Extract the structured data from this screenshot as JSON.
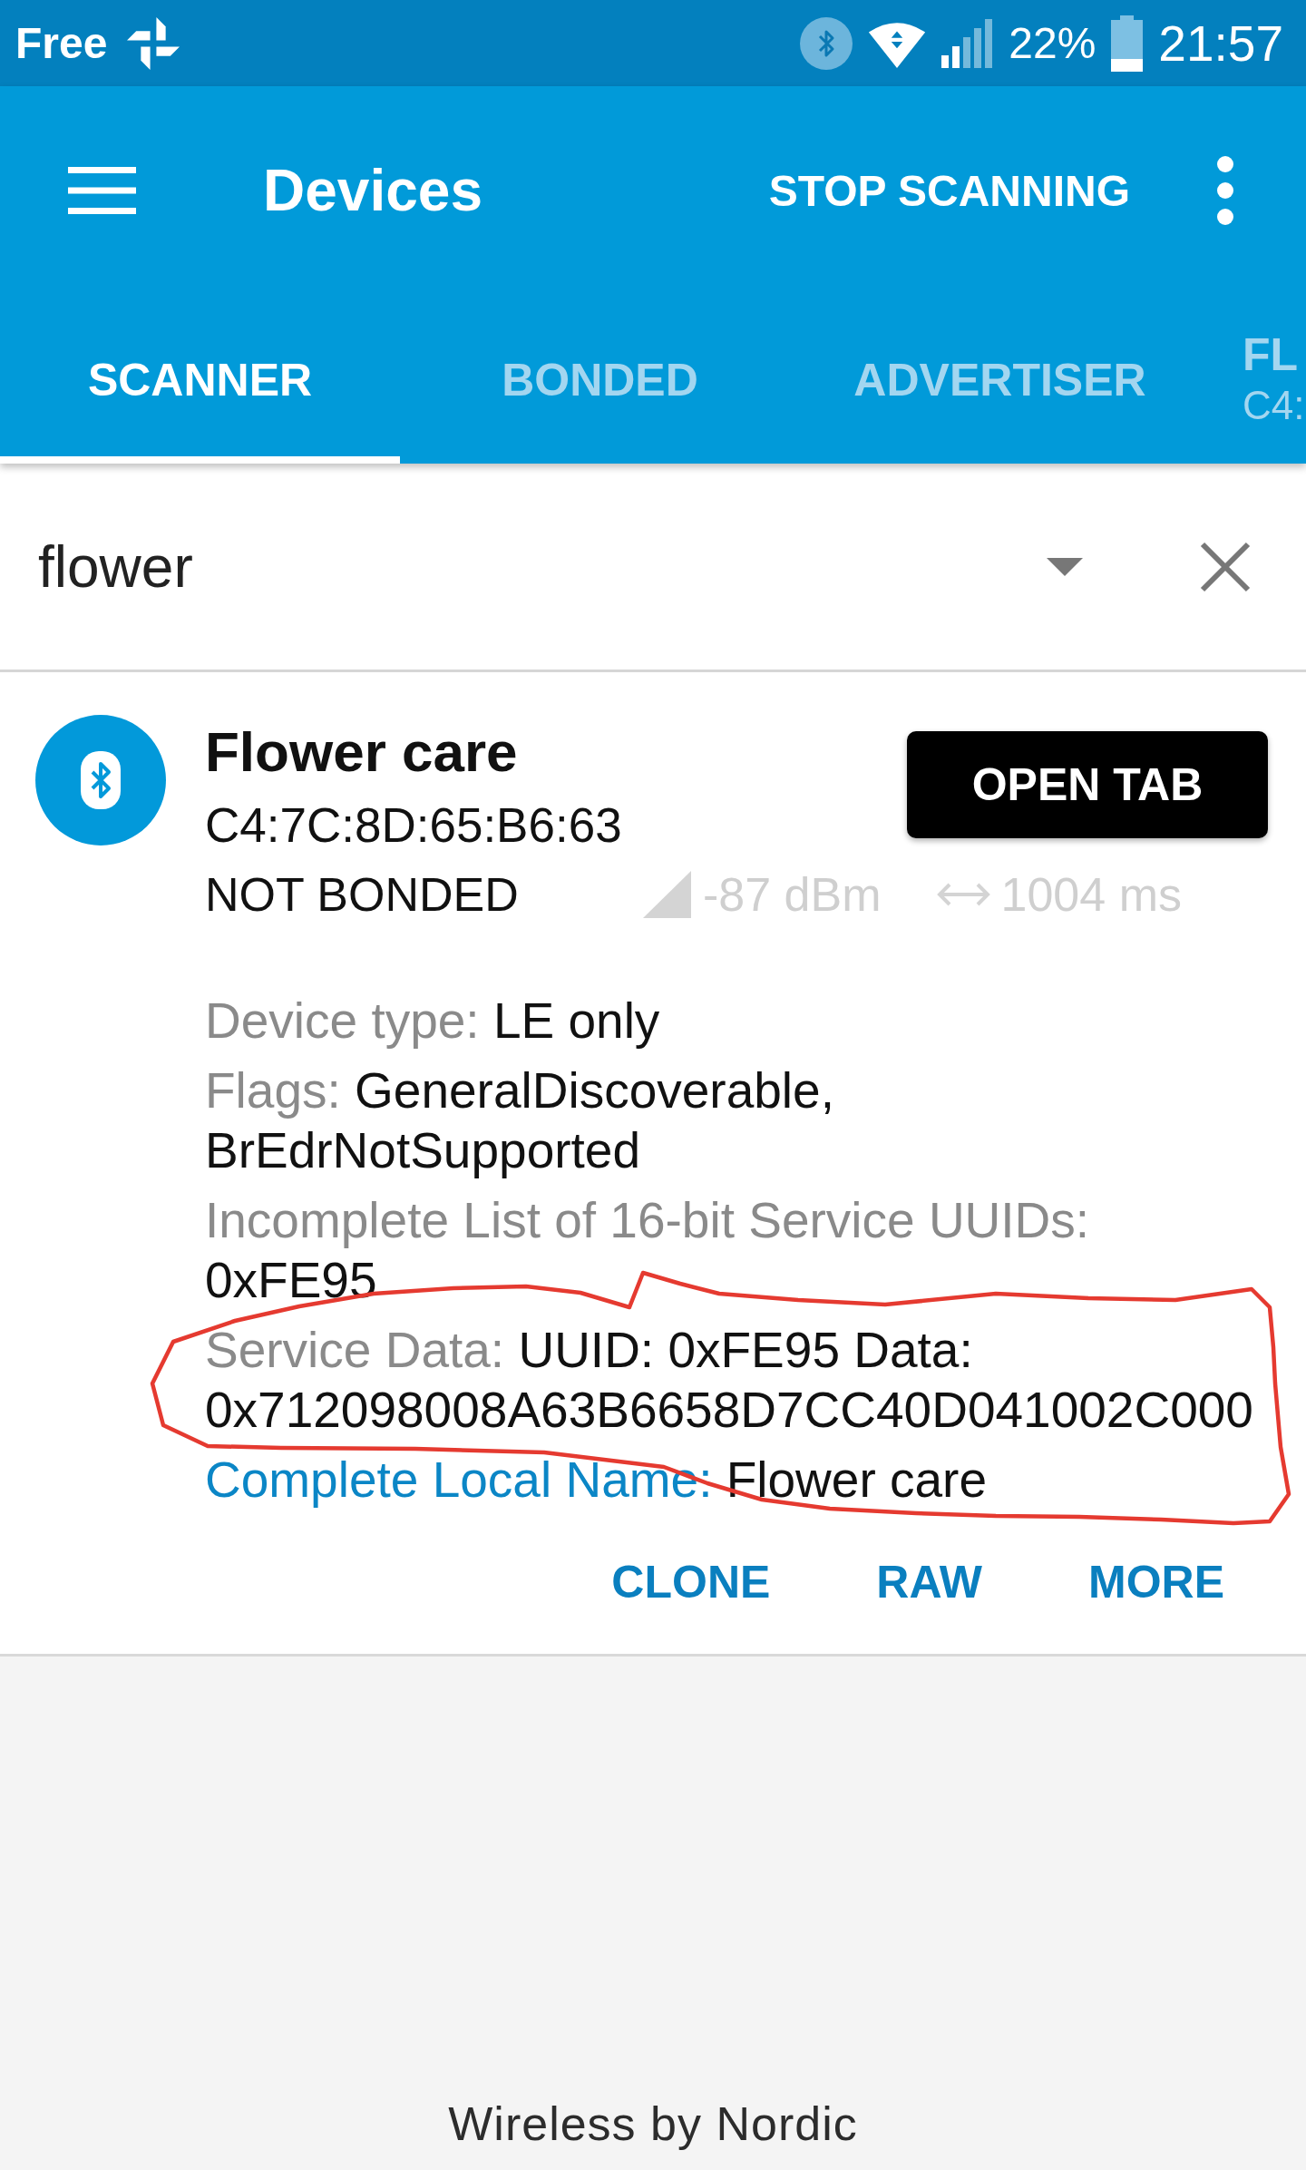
{
  "status_bar": {
    "carrier": "Free",
    "battery": "22%",
    "time": "21:57"
  },
  "app_bar": {
    "title": "Devices",
    "action": "STOP SCANNING"
  },
  "tabs": [
    {
      "kind": "text",
      "label": "SCANNER",
      "selected": true
    },
    {
      "kind": "text",
      "label": "BONDED",
      "selected": false
    },
    {
      "kind": "text",
      "label": "ADVERTISER",
      "selected": false
    },
    {
      "kind": "device",
      "label": "FL",
      "detail": "C4:",
      "selected": false
    }
  ],
  "filter": {
    "value": "flower"
  },
  "devices": [
    {
      "name": "Flower care",
      "address": "C4:7C:8D:65:B6:63",
      "bond_state": "NOT BONDED",
      "rssi": "-87 dBm",
      "interval": "1004 ms",
      "action": "OPEN TAB",
      "details": [
        {
          "label": "Device type:",
          "value": "LE only",
          "highlighted": false
        },
        {
          "label": "Flags:",
          "value": "GeneralDiscoverable, BrEdrNotSupported",
          "highlighted": false
        },
        {
          "label": "Incomplete List of 16-bit Service UUIDs:",
          "value": "0xFE95",
          "highlighted": false
        },
        {
          "label": "Service Data:",
          "value": "UUID: 0xFE95 Data: 0x712098008A63B6658D7CC40D041002C000",
          "highlighted": false
        },
        {
          "label": "Complete Local Name:",
          "value": "Flower care",
          "highlighted": true
        }
      ],
      "buttons": [
        "CLONE",
        "RAW",
        "MORE"
      ]
    }
  ],
  "footer": "Wireless by Nordic"
}
